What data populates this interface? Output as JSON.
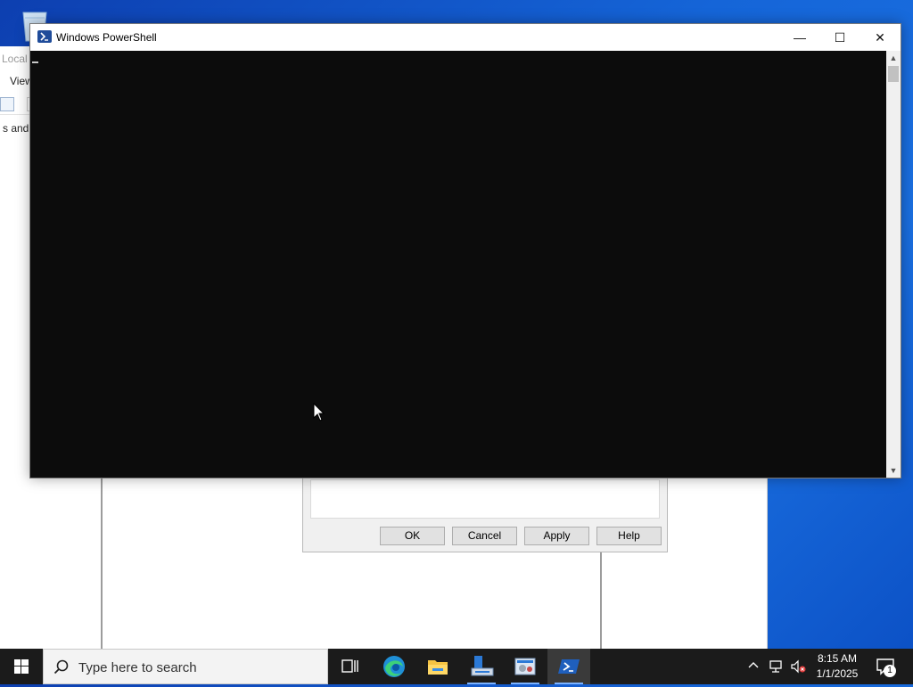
{
  "desktop": {
    "recycle_bin_icon": "recycle-bin-icon"
  },
  "background_window": {
    "title_partial": "Local",
    "menu_view": "View",
    "tree_item_partial": "s and G"
  },
  "properties_dialog": {
    "buttons": {
      "ok": "OK",
      "cancel": "Cancel",
      "apply": "Apply",
      "help": "Help"
    }
  },
  "powershell": {
    "title": "Windows PowerShell",
    "controls": {
      "minimize": "—",
      "maximize": "☐",
      "close": "✕"
    },
    "scroll_up": "▲",
    "scroll_down": "▼"
  },
  "taskbar": {
    "search_placeholder": "Type here to search",
    "apps": [
      "task-view-icon",
      "edge-icon",
      "file-explorer-icon",
      "server-manager-icon",
      "mmc-icon",
      "powershell-icon"
    ],
    "tray": {
      "chevron": "^"
    },
    "clock": {
      "time": "8:15 AM",
      "date": "1/1/2025"
    },
    "notification_count": "1"
  },
  "colors": {
    "console_bg": "#0c0c0c",
    "taskbar_bg": "#1b1b1b",
    "accent": "#1f4c9a"
  }
}
